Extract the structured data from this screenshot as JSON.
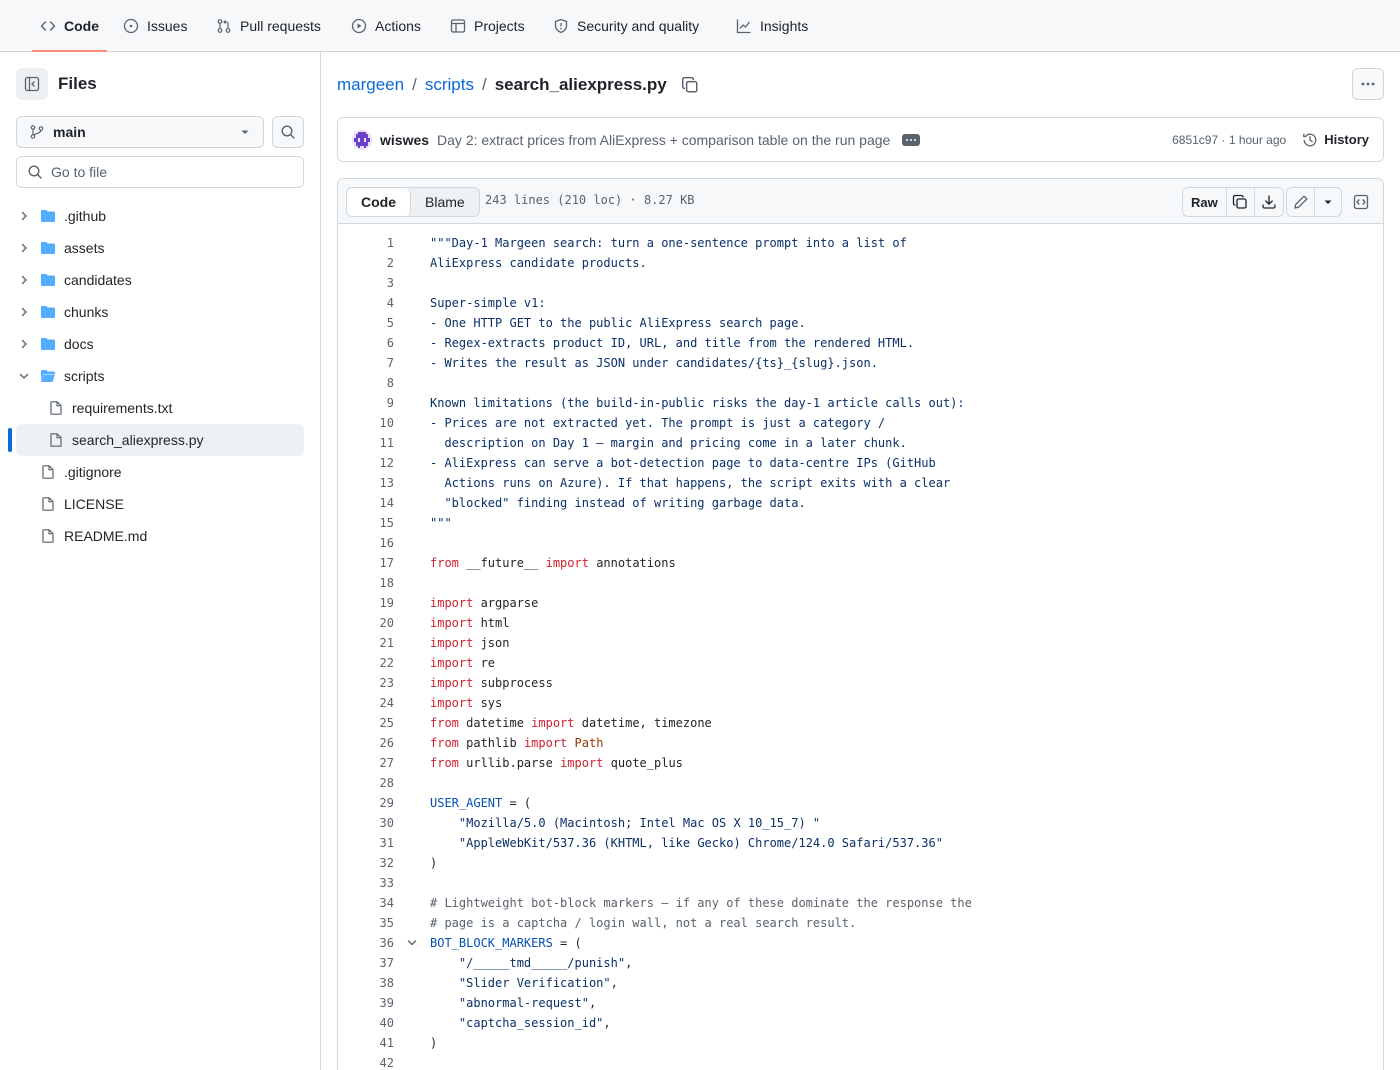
{
  "nav": {
    "tabs": [
      {
        "label": "Code",
        "icon": "code-icon",
        "active": true
      },
      {
        "label": "Issues",
        "icon": "issue-opened-icon"
      },
      {
        "label": "Pull requests",
        "icon": "git-pull-request-icon"
      },
      {
        "label": "Actions",
        "icon": "play-icon"
      },
      {
        "label": "Projects",
        "icon": "table-icon"
      },
      {
        "label": "Security and quality",
        "icon": "shield-icon"
      },
      {
        "label": "Insights",
        "icon": "graph-icon"
      }
    ]
  },
  "sidebar": {
    "title": "Files",
    "branch": "main",
    "search_placeholder": "Go to file",
    "tree": [
      {
        "name": ".github",
        "type": "dir",
        "expanded": false
      },
      {
        "name": "assets",
        "type": "dir",
        "expanded": false
      },
      {
        "name": "candidates",
        "type": "dir",
        "expanded": false
      },
      {
        "name": "chunks",
        "type": "dir",
        "expanded": false
      },
      {
        "name": "docs",
        "type": "dir",
        "expanded": false
      },
      {
        "name": "scripts",
        "type": "dir",
        "expanded": true
      },
      {
        "name": "requirements.txt",
        "type": "file",
        "nested": true
      },
      {
        "name": "search_aliexpress.py",
        "type": "file",
        "nested": true,
        "selected": true
      },
      {
        "name": ".gitignore",
        "type": "file"
      },
      {
        "name": "LICENSE",
        "type": "file"
      },
      {
        "name": "README.md",
        "type": "file"
      }
    ]
  },
  "breadcrumb": {
    "repo": "margeen",
    "folder": "scripts",
    "file": "search_aliexpress.py",
    "separator": "/"
  },
  "commit": {
    "author": "wiswes",
    "message": "Day 2: extract prices from AliExpress + comparison table on the run page",
    "meta": "6851c97 · 1 hour ago",
    "history_label": "History"
  },
  "code_toolbar": {
    "code_tab": "Code",
    "blame_tab": "Blame",
    "file_info": "243 lines (210 loc) · 8.27 KB",
    "raw_label": "Raw"
  },
  "code_lines": [
    "\"\"\"Day-1 Margeen search: turn a one-sentence prompt into a list of",
    "AliExpress candidate products.",
    "",
    "Super-simple v1:",
    "- One HTTP GET to the public AliExpress search page.",
    "- Regex-extracts product ID, URL, and title from the rendered HTML.",
    "- Writes the result as JSON under candidates/{ts}_{slug}.json.",
    "",
    "Known limitations (the build-in-public risks the day-1 article calls out):",
    "- Prices are not extracted yet. The prompt is just a category /",
    "  description on Day 1 — margin and pricing come in a later chunk.",
    "- AliExpress can serve a bot-detection page to data-centre IPs (GitHub",
    "  Actions runs on Azure). If that happens, the script exits with a clear",
    "  \"blocked\" finding instead of writing garbage data.",
    "\"\"\"",
    "",
    "from __future__ import annotations",
    "",
    "import argparse",
    "import html",
    "import json",
    "import re",
    "import subprocess",
    "import sys",
    "from datetime import datetime, timezone",
    "from pathlib import Path",
    "from urllib.parse import quote_plus",
    "",
    "USER_AGENT = (",
    "    \"Mozilla/5.0 (Macintosh; Intel Mac OS X 10_15_7) \"",
    "    \"AppleWebKit/537.36 (KHTML, like Gecko) Chrome/124.0 Safari/537.36\"",
    ")",
    "",
    "# Lightweight bot-block markers — if any of these dominate the response the",
    "# page is a captcha / login wall, not a real search result.",
    "BOT_BLOCK_MARKERS = (",
    "    \"/_____tmd_____/punish\",",
    "    \"Slider Verification\",",
    "    \"abnormal-request\",",
    "    \"captcha_session_id\",",
    ")",
    ""
  ]
}
